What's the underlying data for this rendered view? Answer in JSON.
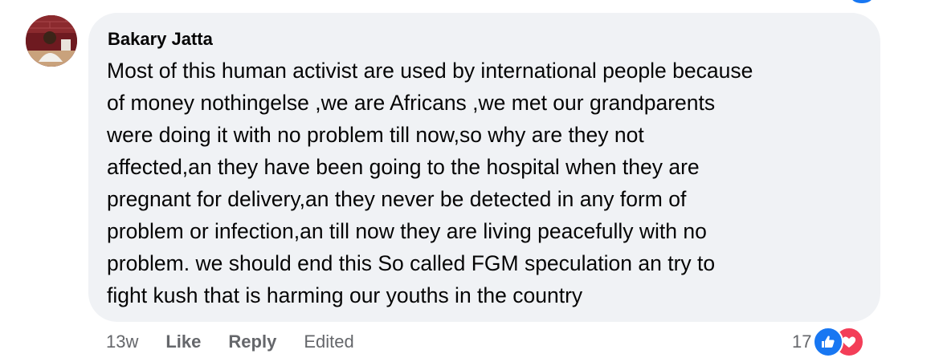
{
  "comment": {
    "author": "Bakary Jatta",
    "text": "Most of this human activist are used by international people because\nof money nothingelse ,we are Africans ,we met our grandparents\nwere doing it with no problem till now,so why are they not\naffected,an they have been going to the hospital when they are\npregnant for delivery,an they never be detected in any form of\nproblem or infection,an till now they are living peacefully with no\nproblem. we should end this So called FGM speculation an try to\nfight kush that is harming our youths in the country",
    "avatar_icon": "profile-photo"
  },
  "actions": {
    "timestamp": "13w",
    "like_label": "Like",
    "reply_label": "Reply",
    "edited_label": "Edited"
  },
  "reactions": {
    "count": "17",
    "icons": [
      "like-icon",
      "love-icon"
    ],
    "like_color": "#1877f2",
    "love_color": "#f33e58"
  },
  "colors": {
    "bubble": "#f0f2f5",
    "text": "#050505",
    "secondary_text": "#65676b"
  }
}
